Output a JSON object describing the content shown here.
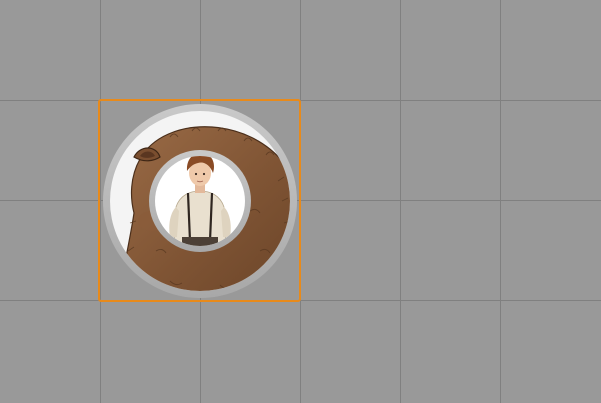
{
  "board": {
    "background_color": "#999999",
    "gridline_color": "#7f7f7f",
    "columns": 6,
    "rows": 4
  },
  "selection": {
    "outline_color": "#e88a1a",
    "selected_column": 2,
    "selected_row": 2
  },
  "tokens": [
    {
      "name": "bear-token",
      "portrait": "brown-bear",
      "ring_color": "#b4b4b4",
      "column": 2,
      "row": 2
    },
    {
      "name": "boy-token",
      "portrait": "boy-with-suspenders",
      "ring_color": "#b4b4b4",
      "column": 2,
      "row": 2
    }
  ]
}
